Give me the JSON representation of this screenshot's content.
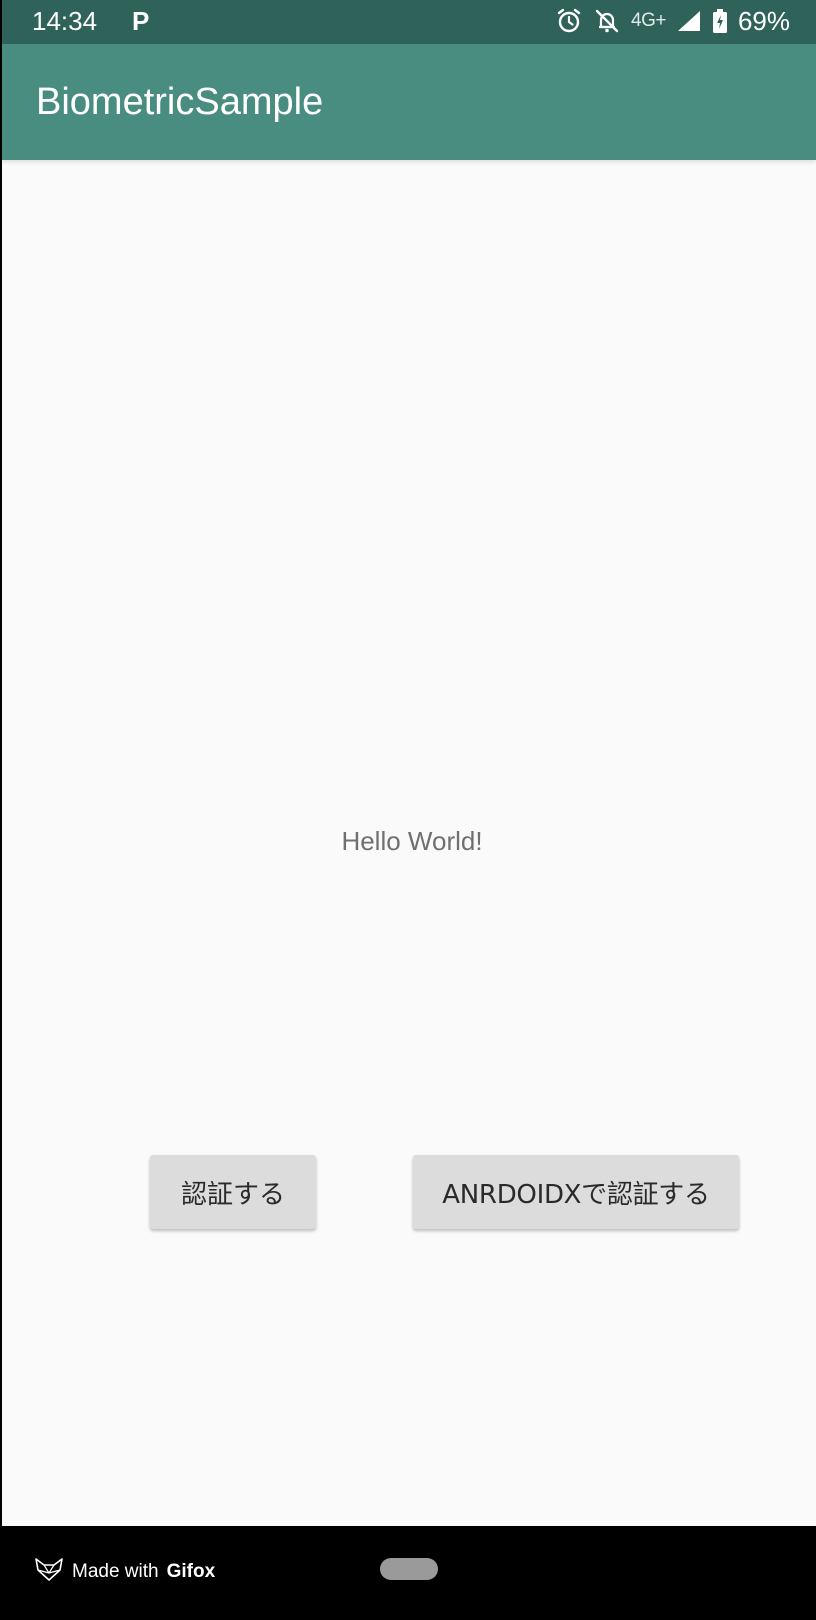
{
  "status_bar": {
    "time": "14:34",
    "notification": "P",
    "network": "4G+",
    "battery_percent": "69%",
    "icons": [
      "alarm-icon",
      "notifications-off-icon",
      "signal-icon",
      "battery-icon"
    ]
  },
  "app_bar": {
    "title": "BiometricSample"
  },
  "content": {
    "hello_text": "Hello World!",
    "auth_button_label": "認証する",
    "androidx_button_label": "ANRDOIDXで認証する"
  },
  "nav_bar": {
    "made_with": "Made with",
    "brand": "Gifox"
  },
  "colors": {
    "status_bar": "#2f6359",
    "app_bar": "#488d80",
    "background": "#fafafa",
    "button": "#dcdcdc"
  }
}
